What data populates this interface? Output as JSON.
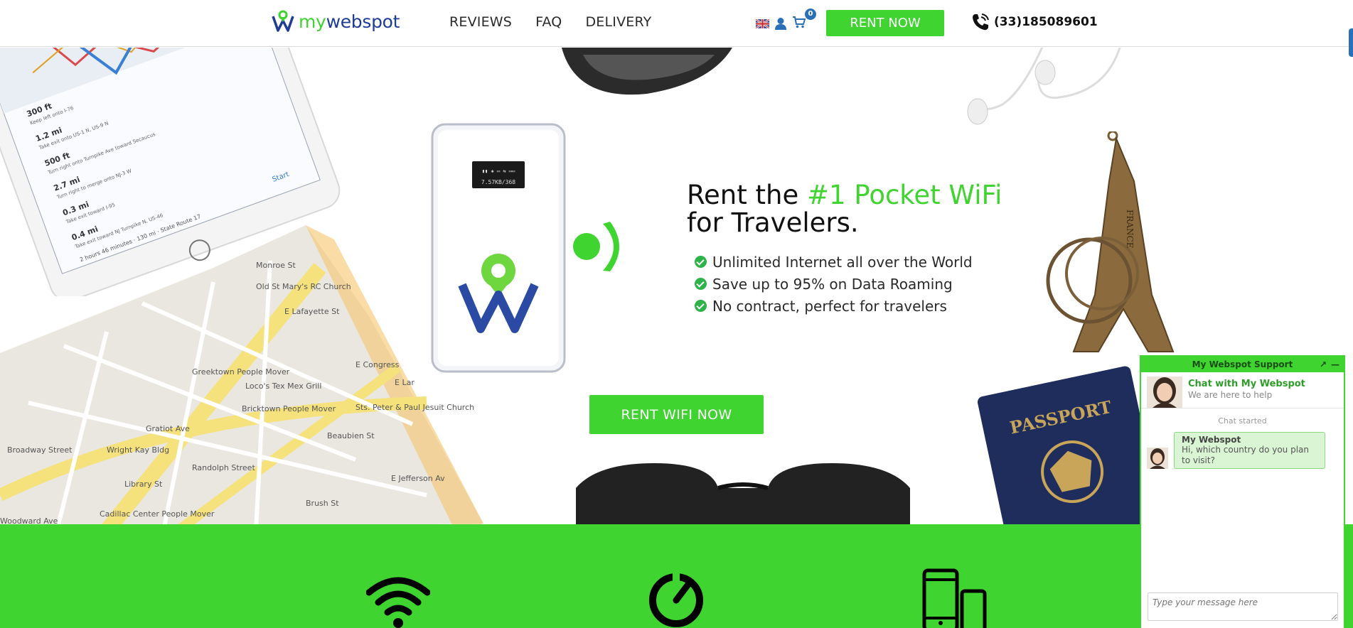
{
  "header": {
    "logo": {
      "prefix": "my",
      "suffix": "webspot"
    },
    "nav": [
      {
        "label": "REVIEWS"
      },
      {
        "label": "FAQ"
      },
      {
        "label": "DELIVERY"
      }
    ],
    "language_icon": "uk-flag-icon",
    "cart_count": "0",
    "rent_now_label": "RENT NOW",
    "phone": "(33)185089601"
  },
  "hero": {
    "headline_prefix": "Rent the ",
    "headline_highlight": "#1 Pocket WiFi",
    "headline_suffix": "for Travelers.",
    "features": [
      {
        "text": "Unlimited Internet all over the World"
      },
      {
        "text": "Save up to 95% on Data Roaming"
      },
      {
        "text": "No contract, perfect for travelers"
      }
    ],
    "device_screen_text": "7.57KB/368",
    "cta_label": "RENT WIFI NOW",
    "decor": {
      "map_labels": [
        "Monroe St",
        "Old St Mary's RC Church",
        "E Lafayette St",
        "Greektown People Mover",
        "Loco's Tex Mex Grill",
        "Broadway Street",
        "Bricktown People Mover",
        "E Congress",
        "Beaubien St",
        "Sts. Peter & Paul Jesuit Church",
        "Library St",
        "Randolph Street",
        "Brush St",
        "Cadillac Center People Mover",
        "Gratiot Ave",
        "Woodward Ave",
        "Wright Kay Bldg",
        "E Jefferson Av",
        "E Lar"
      ],
      "tablet_steps": [
        {
          "dist": "300 ft",
          "desc": "Keep left onto I-76"
        },
        {
          "dist": "1.2 mi",
          "desc": "Take exit onto US-1 N, US-9 N"
        },
        {
          "dist": "500 ft",
          "desc": "Turn right onto Turnpike Ave toward Secaucus"
        },
        {
          "dist": "2.7 mi",
          "desc": "Turn right to merge onto NJ-3 W"
        },
        {
          "dist": "0.3 mi",
          "desc": "Take exit toward I-95"
        },
        {
          "dist": "0.4 mi",
          "desc": "Take exit toward NJ Turnpike N, US-46"
        }
      ],
      "tablet_summary": "2 hours 46 minutes · 130 mi · State Route 17",
      "tablet_start": "Start",
      "passport_label": "PASSPORT",
      "keychain_label": "FRANCE"
    }
  },
  "band": {
    "icons": [
      "wifi-icon",
      "speedometer-icon",
      "mobile-devices-icon"
    ]
  },
  "chat": {
    "title": "My Webspot Support",
    "popout_icon": "popout-icon",
    "minimize_icon": "minimize-icon",
    "intro_title": "Chat with My Webspot",
    "intro_subtitle": "We are here to help",
    "status": "Chat started",
    "message": {
      "sender": "My Webspot",
      "text": "Hi, which country do you plan to visit?"
    },
    "input_placeholder": "Type your message here"
  },
  "colors": {
    "brand_green": "#3fd42f",
    "brand_blue": "#1f3c96",
    "check_green": "#2db34a",
    "badge_blue": "#2a70b8"
  }
}
